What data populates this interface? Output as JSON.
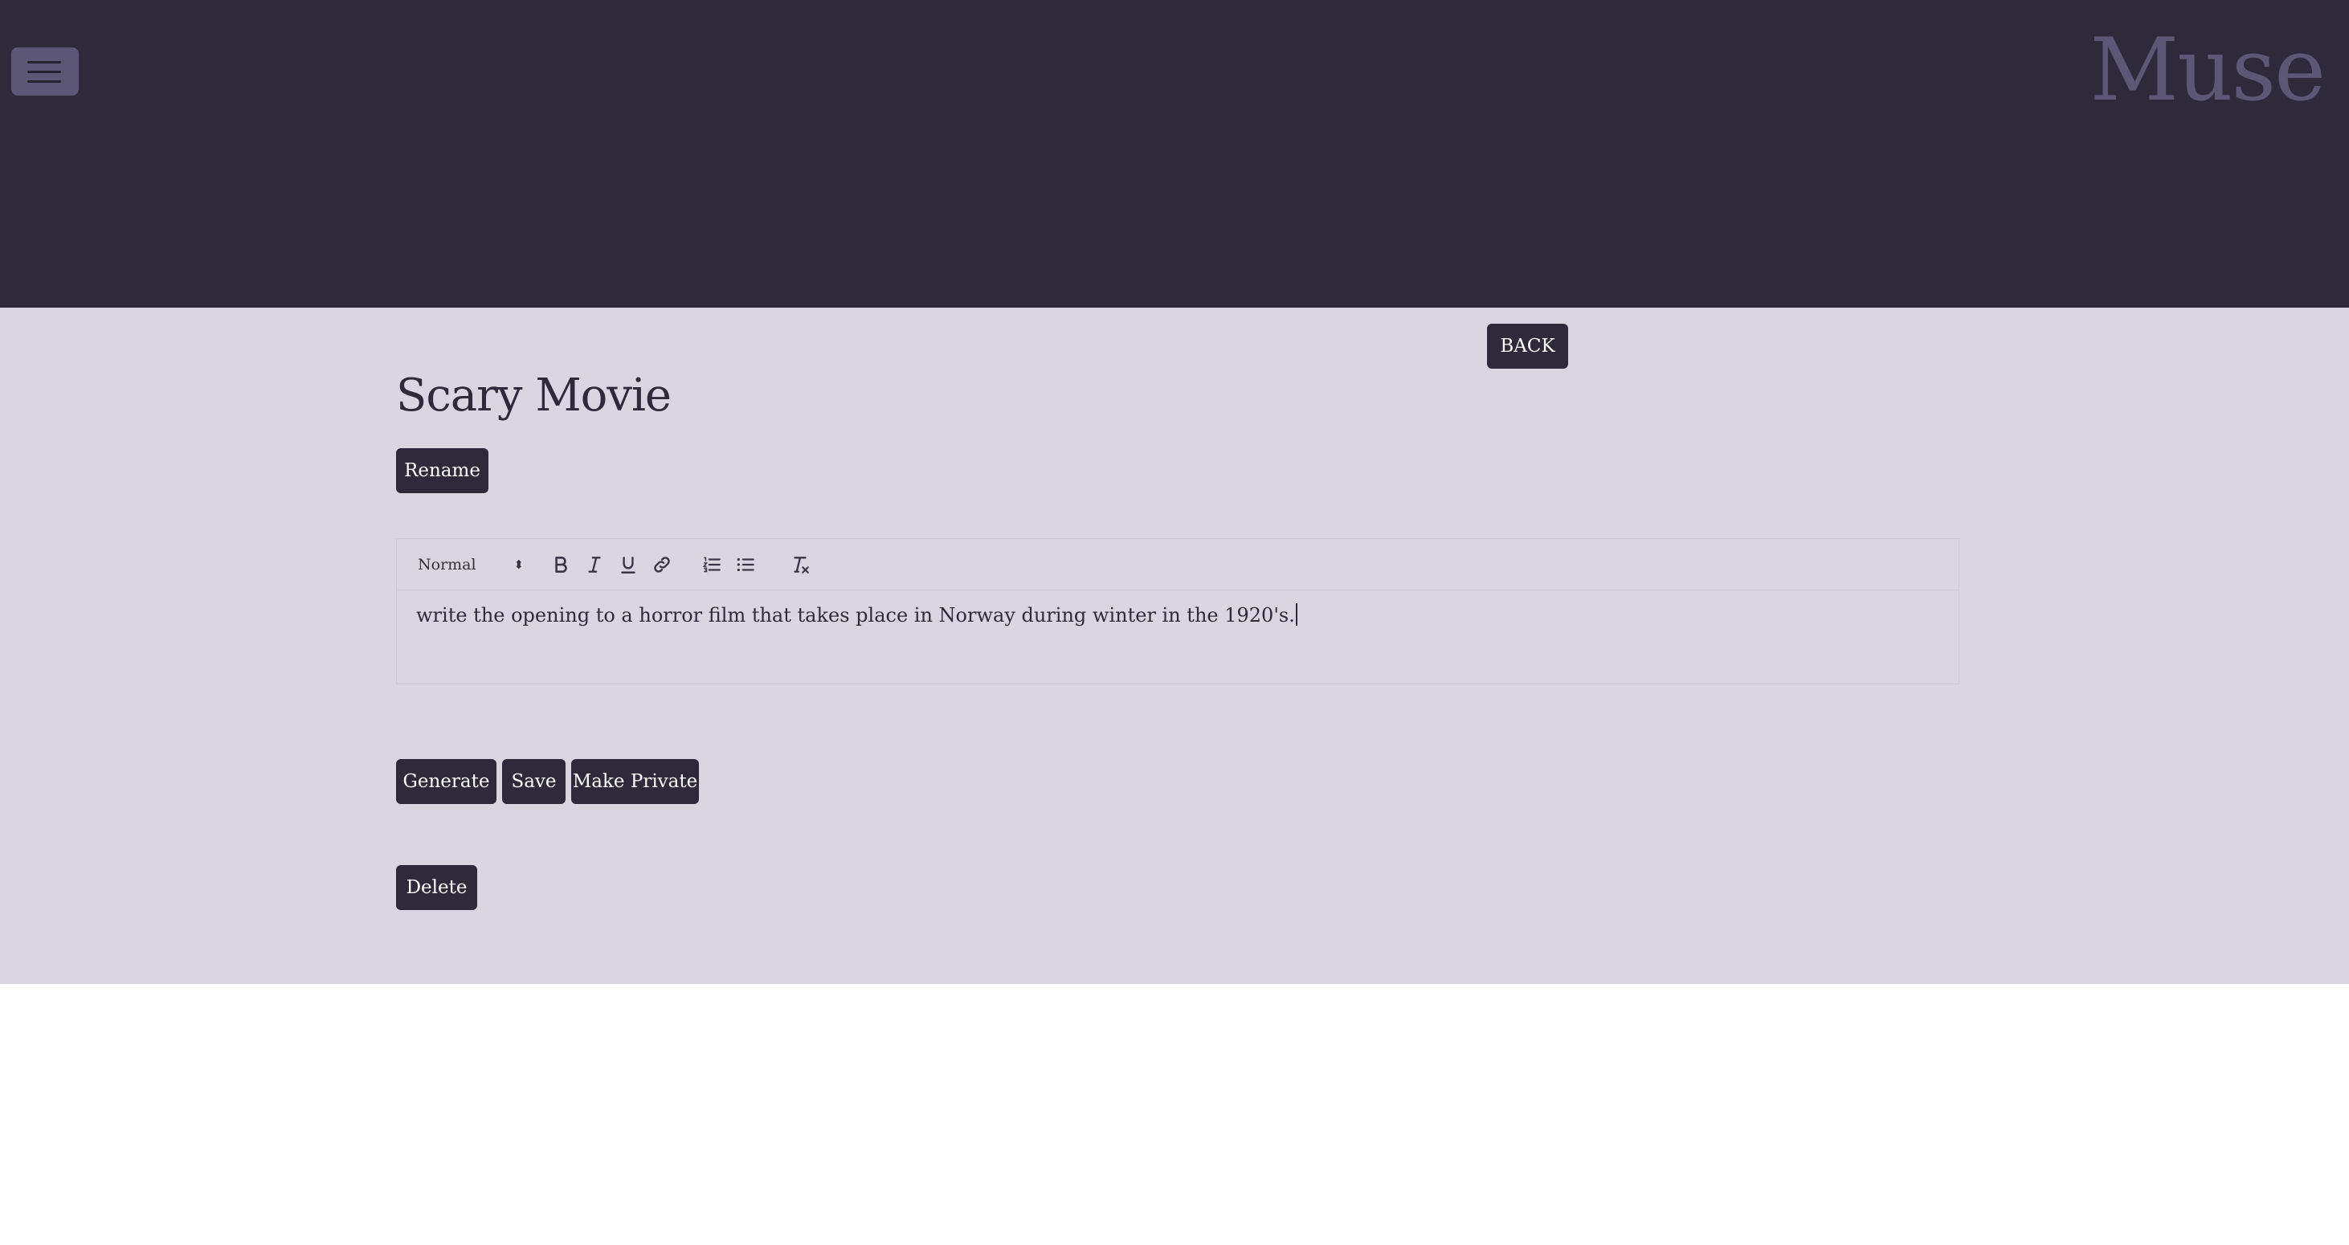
{
  "header": {
    "brand": "Muse",
    "menu_icon": "hamburger-menu-icon"
  },
  "page": {
    "back_label": "BACK",
    "title": "Scary Movie",
    "rename_label": "Rename"
  },
  "editor": {
    "format_select": "Normal",
    "toolbar_icons": [
      "bold-icon",
      "italic-icon",
      "underline-icon",
      "link-icon",
      "ordered-list-icon",
      "bullet-list-icon",
      "clear-format-icon"
    ],
    "content": "write the opening to a horror film that takes place in Norway during winter in the 1920's."
  },
  "actions": {
    "generate_label": "Generate",
    "save_label": "Save",
    "make_private_label": "Make Private",
    "delete_label": "Delete"
  },
  "colors": {
    "header_bg": "#2e2a3c",
    "main_bg": "#d9d6e2",
    "button_bg": "#2e2a3c",
    "brand_text": "#5b5774"
  }
}
